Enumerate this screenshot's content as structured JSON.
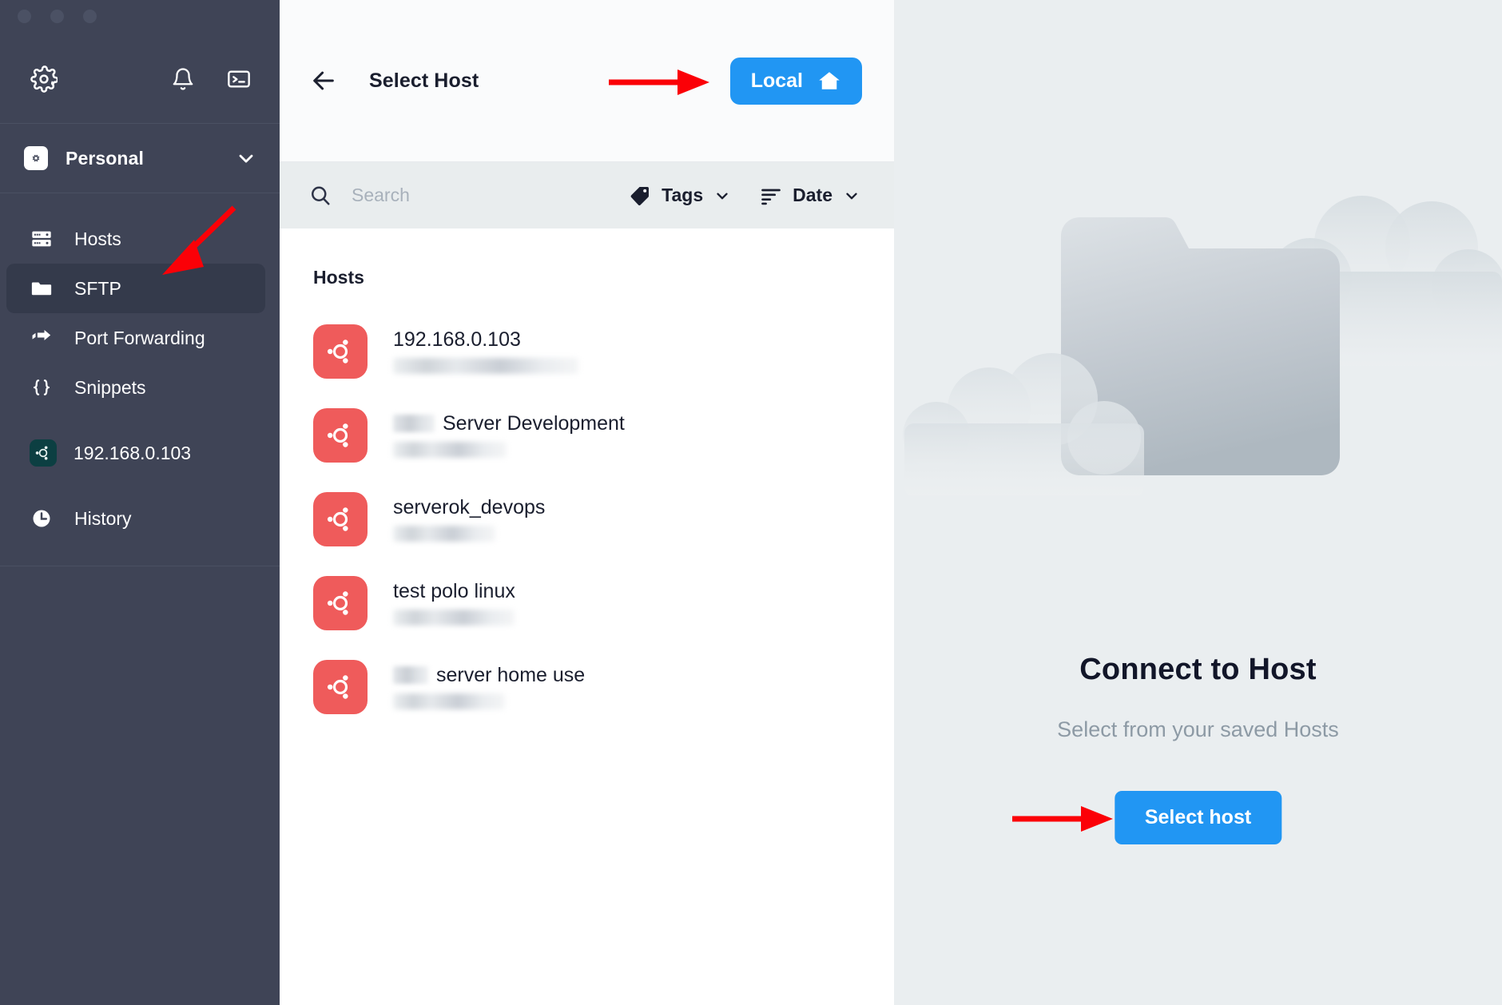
{
  "window": {
    "traffic_lights": [
      "close",
      "minimize",
      "maximize"
    ]
  },
  "sidebar": {
    "toolbar": {
      "settings_icon": "gear-icon",
      "notifications_icon": "bell-icon",
      "terminal_icon": "terminal-icon"
    },
    "vault": {
      "label": "Personal",
      "icon": "vault-icon",
      "chevron": "chevron-down-icon"
    },
    "items": [
      {
        "label": "Hosts",
        "icon": "server-icon",
        "active": false
      },
      {
        "label": "SFTP",
        "icon": "folder-icon",
        "active": true
      },
      {
        "label": "Port Forwarding",
        "icon": "port-forward-icon",
        "active": false
      },
      {
        "label": "Snippets",
        "icon": "braces-icon",
        "active": false
      },
      {
        "label": "192.168.0.103",
        "icon": "ubuntu-icon",
        "active": false
      },
      {
        "label": "History",
        "icon": "clock-icon",
        "active": false
      }
    ]
  },
  "middle": {
    "header": {
      "back_icon": "arrow-left-icon",
      "title": "Select Host",
      "local_button": {
        "label": "Local",
        "icon": "home-icon"
      }
    },
    "search": {
      "placeholder": "Search",
      "value": "",
      "icon": "search-icon"
    },
    "filters": [
      {
        "label": "Tags",
        "icon": "tag-icon",
        "chevron": "chevron-down-icon"
      },
      {
        "label": "Date",
        "icon": "sort-icon",
        "chevron": "chevron-down-icon"
      }
    ],
    "list": {
      "section_title": "Hosts",
      "hosts": [
        {
          "name": "192.168.0.103",
          "prefix_redacted": false,
          "prefix_width": 0,
          "sub_width": 232,
          "icon": "ubuntu-icon"
        },
        {
          "name": "Server Development",
          "prefix_redacted": true,
          "prefix_width": 52,
          "sub_width": 142,
          "icon": "ubuntu-icon"
        },
        {
          "name": "serverok_devops",
          "prefix_redacted": false,
          "prefix_width": 0,
          "sub_width": 128,
          "icon": "ubuntu-icon"
        },
        {
          "name": "test polo linux",
          "prefix_redacted": true,
          "prefix_width": 0,
          "sub_width": 152,
          "icon": "ubuntu-icon"
        },
        {
          "name": "server home use",
          "prefix_redacted": true,
          "prefix_width": 44,
          "sub_width": 140,
          "icon": "ubuntu-icon"
        }
      ]
    }
  },
  "right_panel": {
    "illustration": "folder-clouds-illustration",
    "title": "Connect to Host",
    "subtitle": "Select from your saved Hosts",
    "button_label": "Select host"
  },
  "annotations": {
    "color": "#fb0007",
    "arrows": [
      {
        "name": "arrow-to-local-button",
        "points_to": "Local"
      },
      {
        "name": "arrow-to-sftp-item",
        "points_to": "SFTP"
      },
      {
        "name": "arrow-to-select-host-button",
        "points_to": "Select host"
      }
    ]
  },
  "colors": {
    "sidebar_bg": "#3f4456",
    "sidebar_active": "#343a4b",
    "accent_blue": "#2196f3",
    "host_avatar": "#ef5b5b",
    "right_panel_bg": "#eaeef0",
    "search_bar_bg": "#e9edee",
    "text_dark": "#1a1e2e",
    "annotation_red": "#fb0007"
  }
}
